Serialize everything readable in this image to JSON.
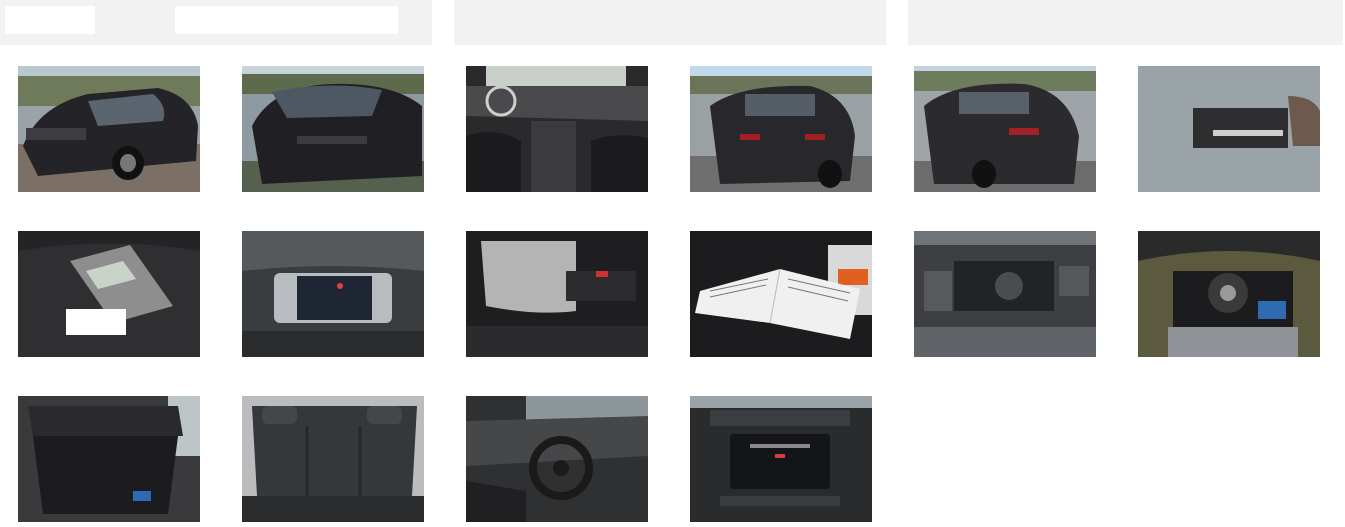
{
  "header": {
    "tabs": [
      "",
      "",
      ""
    ]
  },
  "gallery": {
    "photos": [
      {
        "subject": "car-front-three-quarter",
        "color": "#2b2b30"
      },
      {
        "subject": "car-front",
        "color": "#27272b"
      },
      {
        "subject": "car-interior-dashboard",
        "color": "#3a3a3c"
      },
      {
        "subject": "car-rear-three-quarter",
        "color": "#2a2a2e"
      },
      {
        "subject": "car-rear",
        "color": "#2c2c30"
      },
      {
        "subject": "vin-plate",
        "color": "#8a8f93"
      },
      {
        "subject": "owner-manual-in-trunk",
        "color": "#262626"
      },
      {
        "subject": "instrument-cluster",
        "color": "#2e3134"
      },
      {
        "subject": "door-panel",
        "color": "#1f1f21"
      },
      {
        "subject": "service-booklet",
        "color": "#1e1e20"
      },
      {
        "subject": "engine-bay",
        "color": "#3b3d40"
      },
      {
        "subject": "spare-wheel-well",
        "color": "#4a4a3a"
      },
      {
        "subject": "open-trunk",
        "color": "#303032"
      },
      {
        "subject": "rear-seats",
        "color": "#3d3e40"
      },
      {
        "subject": "steering-wheel",
        "color": "#2f3032"
      },
      {
        "subject": "infotainment-screen",
        "color": "#232325"
      }
    ]
  }
}
